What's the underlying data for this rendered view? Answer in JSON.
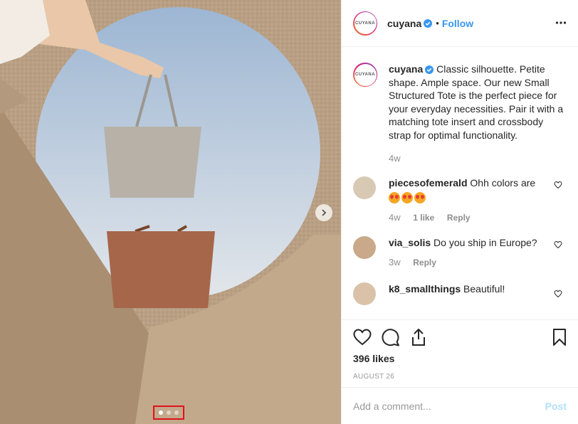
{
  "post": {
    "image_alt": "",
    "carousel": {
      "total": 3,
      "active_index": 0
    }
  },
  "header": {
    "avatar_text": "CUYANA",
    "username": "cuyana",
    "separator": "•",
    "follow_label": "Follow"
  },
  "caption": {
    "avatar_text": "CUYANA",
    "username": "cuyana",
    "text": "Classic silhouette. Petite shape. Ample space. Our new Small Structured Tote is the perfect piece for your everyday necessities. Pair it with a matching tote insert and crossbody strap for optimal functionality.",
    "time": "4w"
  },
  "comments": [
    {
      "username": "piecesofemerald",
      "text": "Ohh colors are",
      "emoji_count": 3,
      "time": "4w",
      "likes": "1 like",
      "reply": "Reply",
      "avatar_color": "#d8c9b5"
    },
    {
      "username": "via_solis",
      "text": "Do you ship in Europe?",
      "time": "3w",
      "reply": "Reply",
      "avatar_color": "#c9a98a"
    },
    {
      "username": "k8_smallthings",
      "text": "Beautiful!",
      "avatar_color": "#d9c2a8"
    }
  ],
  "stats": {
    "likes": "396 likes",
    "date": "AUGUST 26"
  },
  "add_comment": {
    "placeholder": "Add a comment...",
    "post_label": "Post"
  },
  "colors": {
    "link_blue": "#3897f0",
    "post_disabled": "#b2dffc",
    "highlight_red": "#e0121b"
  }
}
